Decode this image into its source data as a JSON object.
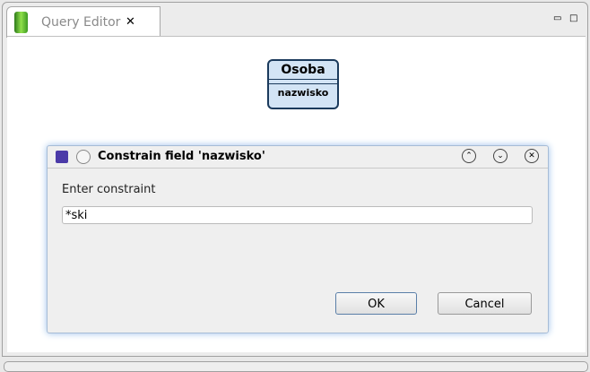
{
  "editor": {
    "tab_label": "Query Editor",
    "close_glyph": "✕",
    "minimize_glyph": "▭",
    "maximize_glyph": "□"
  },
  "entity": {
    "name": "Osoba",
    "field": "nazwisko"
  },
  "dialog": {
    "title": "Constrain field 'nazwisko'",
    "prompt": "Enter constraint",
    "input_value": "*ski",
    "ok_label": "OK",
    "cancel_label": "Cancel",
    "collapse_glyph": "⌃",
    "menu_glyph": "⌄",
    "close_glyph": "✕"
  }
}
